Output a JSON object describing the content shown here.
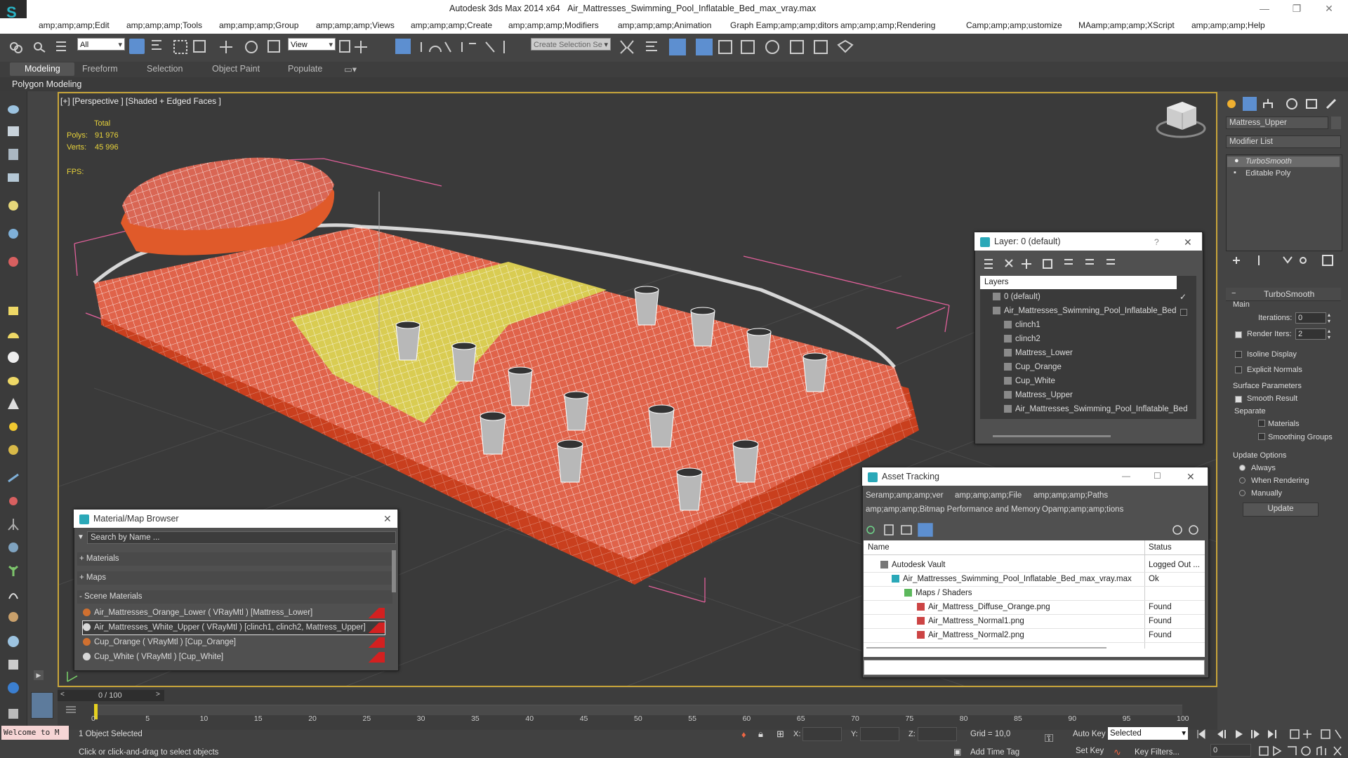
{
  "window": {
    "app_title": "Autodesk 3ds Max  2014 x64",
    "file_title": "Air_Mattresses_Swimming_Pool_Inflatable_Bed_max_vray.max",
    "minimize_glyph": "—",
    "maximize_glyph": "❐",
    "close_glyph": "✕"
  },
  "menu": [
    "amp;amp;amp;Edit",
    "amp;amp;amp;Tools",
    "amp;amp;amp;Group",
    "amp;amp;amp;Views",
    "amp;amp;amp;Create",
    "amp;amp;amp;Modifiers",
    "amp;amp;amp;Animation",
    "Graph Eamp;amp;amp;ditors",
    "amp;amp;amp;Rendering",
    "Camp;amp;amp;ustomize",
    "MAamp;amp;amp;XScript",
    "amp;amp;amp;Help"
  ],
  "toolbar": {
    "filter_value": "All",
    "refcoord_value": "View",
    "selection_set_placeholder": "Create Selection Se"
  },
  "ribbon": {
    "tabs": [
      "Modeling",
      "Freeform",
      "Selection",
      "Object Paint",
      "Populate"
    ],
    "sub_label": "Polygon Modeling"
  },
  "viewport": {
    "label": "[+] [Perspective ] [Shaded + Edged Faces ]",
    "stats_header": "Total",
    "polys_label": "Polys:",
    "polys_value": "91 976",
    "verts_label": "Verts:",
    "verts_value": "45 996",
    "fps_label": "FPS:"
  },
  "command_panel": {
    "object_name": "Mattress_Upper",
    "modifier_list": "Modifier List",
    "stack": [
      "TurboSmooth",
      "Editable Poly"
    ],
    "rollout_title": "TurboSmooth",
    "main_label": "Main",
    "iterations_label": "Iterations:",
    "iterations_value": "0",
    "render_iters_label": "Render Iters:",
    "render_iters_value": "2",
    "isoline_label": "Isoline Display",
    "explicit_label": "Explicit Normals",
    "surface_label": "Surface Parameters",
    "smooth_result_label": "Smooth Result",
    "separate_label": "Separate",
    "materials_label": "Materials",
    "smoothing_groups_label": "Smoothing Groups",
    "update_options_label": "Update Options",
    "always_label": "Always",
    "when_rendering_label": "When Rendering",
    "manually_label": "Manually",
    "update_button": "Update"
  },
  "layer_window": {
    "title": "Layer: 0 (default)",
    "help_glyph": "?",
    "column": "Layers",
    "items": [
      {
        "name": "0 (default)",
        "level": 0
      },
      {
        "name": "Air_Mattresses_Swimming_Pool_Inflatable_Bed",
        "level": 0
      },
      {
        "name": "clinch1",
        "level": 1
      },
      {
        "name": "clinch2",
        "level": 1
      },
      {
        "name": "Mattress_Lower",
        "level": 1
      },
      {
        "name": "Cup_Orange",
        "level": 1
      },
      {
        "name": "Cup_White",
        "level": 1
      },
      {
        "name": "Mattress_Upper",
        "level": 1
      },
      {
        "name": "Air_Mattresses_Swimming_Pool_Inflatable_Bed",
        "level": 1
      }
    ]
  },
  "material_browser": {
    "title": "Material/Map Browser",
    "search_placeholder": "Search by Name ...",
    "groups": [
      "+ Materials",
      "+ Maps",
      "- Scene Materials"
    ],
    "materials": [
      "Air_Mattresses_Orange_Lower ( VRayMtl ) [Mattress_Lower]",
      "Air_Mattresses_White_Upper ( VRayMtl ) [clinch1, clinch2, Mattress_Upper]",
      "Cup_Orange ( VRayMtl ) [Cup_Orange]",
      "Cup_White ( VRayMtl ) [Cup_White]"
    ]
  },
  "asset_tracking": {
    "title": "Asset Tracking",
    "menu_row1": [
      "Seramp;amp;amp;ver",
      "amp;amp;amp;File",
      "amp;amp;amp;Paths"
    ],
    "menu_row2": [
      "amp;amp;amp;Bitmap Performance and Memory",
      "Opamp;amp;amp;tions"
    ],
    "col_name": "Name",
    "col_status": "Status",
    "rows": [
      {
        "name": "Autodesk Vault",
        "status": "Logged Out ..."
      },
      {
        "name": "Air_Mattresses_Swimming_Pool_Inflatable_Bed_max_vray.max",
        "status": "Ok"
      },
      {
        "name": "Maps / Shaders",
        "status": ""
      },
      {
        "name": "Air_Mattress_Diffuse_Orange.png",
        "status": "Found"
      },
      {
        "name": "Air_Mattress_Normal1.png",
        "status": "Found"
      },
      {
        "name": "Air_Mattress_Normal2.png",
        "status": "Found"
      }
    ]
  },
  "timeline": {
    "frame_display": "0 / 100",
    "ticks": [
      "0",
      "5",
      "10",
      "15",
      "20",
      "25",
      "30",
      "35",
      "40",
      "45",
      "50",
      "55",
      "60",
      "65",
      "70",
      "75",
      "80",
      "85",
      "90",
      "95",
      "100"
    ]
  },
  "status": {
    "script_box": "Welcome to M",
    "selection_info": "1 Object Selected",
    "prompt": "Click or click-and-drag to select objects",
    "x_label": "X:",
    "y_label": "Y:",
    "z_label": "Z:",
    "grid": "Grid = 10,0",
    "add_time_tag": "Add Time Tag",
    "auto_key": "Auto Key",
    "selected_value": "Selected",
    "set_key": "Set Key",
    "key_filters": "Key Filters...",
    "frame_value": "0"
  },
  "colors": {
    "mattress_orange": "#e0634a",
    "yellow_mesh": "#d9cc52",
    "wire": "#ffffff",
    "selection_bracket": "#e0609a"
  }
}
